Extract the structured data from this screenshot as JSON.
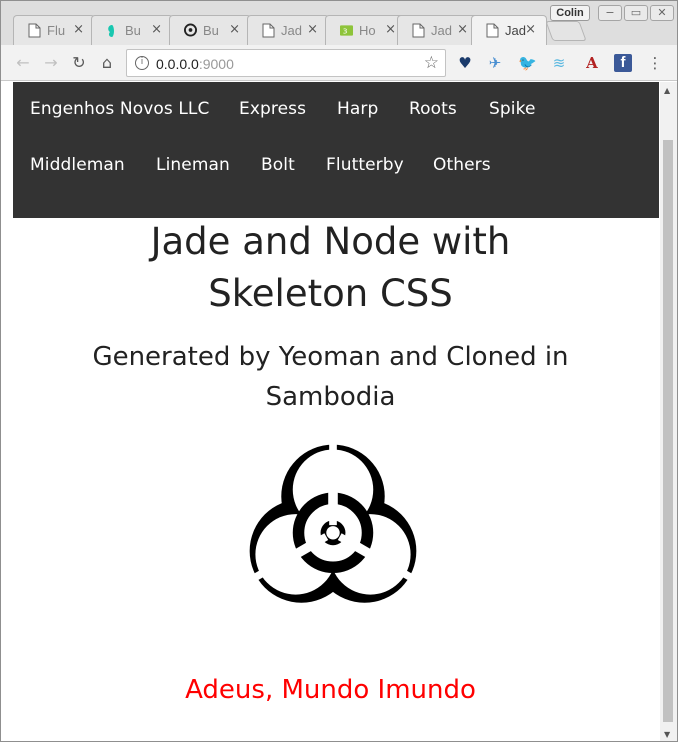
{
  "browser": {
    "tabs": [
      {
        "label": "Flu",
        "icon": "page-icon",
        "active": false
      },
      {
        "label": "Bu",
        "icon": "butterfly-icon",
        "active": false
      },
      {
        "label": "Bu",
        "icon": "biohazard-icon",
        "active": false
      },
      {
        "label": "Jad",
        "icon": "page-icon",
        "active": false
      },
      {
        "label": "Ho",
        "icon": "w3-icon",
        "active": false
      },
      {
        "label": "Jad",
        "icon": "page-icon",
        "active": false
      },
      {
        "label": "Jad",
        "icon": "page-icon",
        "active": true
      }
    ],
    "profile_name": "Colin",
    "url_host": "0.0.0.0",
    "url_port": ":9000",
    "tab_close_glyph": "×"
  },
  "page": {
    "nav": {
      "items": [
        "Engenhos Novos LLC",
        "Express",
        "Harp",
        "Roots",
        "Spike",
        "Middleman",
        "Lineman",
        "Bolt",
        "Flutterby",
        "Others"
      ]
    },
    "title_line1": "Jade and Node with",
    "title_line2": "Skeleton CSS",
    "subtitle_line1": "Generated by Yeoman and Cloned in",
    "subtitle_line2": "Sambodia",
    "footer_message": "Adeus, Mundo Imundo",
    "colors": {
      "navbar_bg": "#333333",
      "footer_message": "#ff0000"
    }
  }
}
